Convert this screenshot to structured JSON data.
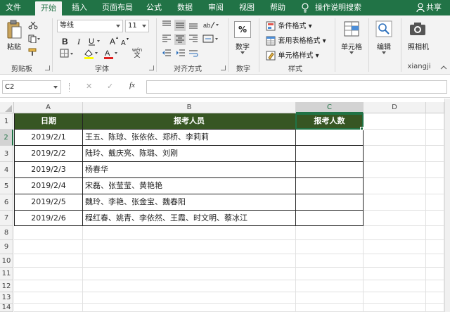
{
  "tabs": [
    "文件",
    "开始",
    "插入",
    "页面布局",
    "公式",
    "数据",
    "审阅",
    "视图",
    "帮助"
  ],
  "tell_me": "操作说明搜索",
  "share": "共享",
  "ribbon": {
    "clipboard": {
      "paste": "粘贴",
      "label": "剪贴板"
    },
    "font": {
      "name": "等线",
      "size": "11",
      "wen": "wén",
      "wen_char": "文",
      "label": "字体"
    },
    "alignment": {
      "label": "对齐方式"
    },
    "number": {
      "percent": "%",
      "label": "数字"
    },
    "styles": {
      "conditional": "条件格式",
      "table_format": "套用表格格式",
      "cell_styles": "单元格样式",
      "label": "样式"
    },
    "cells": {
      "label": "单元格"
    },
    "editing": {
      "label": "编辑"
    },
    "camera": {
      "label": "照相机",
      "group_label": "xiangji"
    }
  },
  "formula_bar": {
    "name_box": "C2",
    "fx": "fx",
    "cancel": "✕",
    "enter": "✓"
  },
  "columns": [
    "A",
    "B",
    "C",
    "D"
  ],
  "rows": [
    "1",
    "2",
    "3",
    "4",
    "5",
    "6",
    "7",
    "8",
    "9",
    "10",
    "11",
    "12",
    "13",
    "14"
  ],
  "table": {
    "headers": [
      "日期",
      "报考人员",
      "报考人数"
    ],
    "rows": [
      {
        "date": "2019/2/1",
        "people": "王五、陈琼、张依依、郑桥、李莉莉"
      },
      {
        "date": "2019/2/2",
        "people": "陆玲、戴庆亮、陈璐、刘刚"
      },
      {
        "date": "2019/2/3",
        "people": "杨春华"
      },
      {
        "date": "2019/2/4",
        "people": "宋磊、张莹莹、黄艳艳"
      },
      {
        "date": "2019/2/5",
        "people": "魏玲、李艳、张金宝、魏春阳"
      },
      {
        "date": "2019/2/6",
        "people": "程红春、姚青、李依然、王霞、时文明、蔡冰江"
      }
    ]
  },
  "colors": {
    "excel_green": "#217346",
    "header_fill": "#375623"
  }
}
